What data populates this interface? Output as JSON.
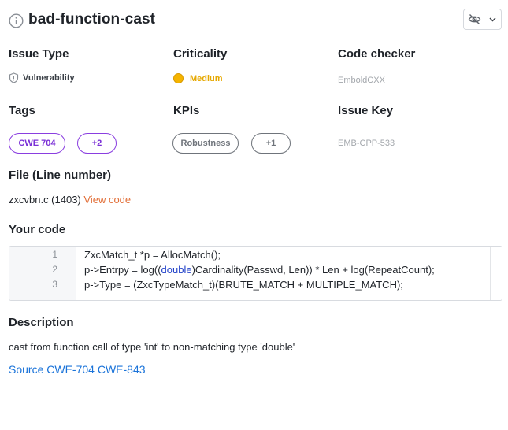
{
  "header": {
    "title": "bad-function-cast",
    "info_icon": "info-circle-icon",
    "visibility_icon": "eye-off-icon",
    "dropdown_icon": "chevron-down-icon"
  },
  "issue_type": {
    "heading": "Issue Type",
    "value": "Vulnerability",
    "icon": "shield-icon"
  },
  "criticality": {
    "heading": "Criticality",
    "value": "Medium",
    "color": "#f5b400"
  },
  "code_checker": {
    "heading": "Code checker",
    "value": "EmboldCXX"
  },
  "tags": {
    "heading": "Tags",
    "items": [
      "CWE 704",
      "+2"
    ],
    "color": "#7a2fd6"
  },
  "kpis": {
    "heading": "KPIs",
    "items": [
      "Robustness",
      "+1"
    ]
  },
  "issue_key": {
    "heading": "Issue Key",
    "value": "EMB-CPP-533"
  },
  "file": {
    "heading": "File (Line number)",
    "name": "zxcvbn.c (1403)",
    "view_code": "View code"
  },
  "your_code": {
    "heading": "Your code",
    "lines": [
      {
        "number": "1",
        "pre": "ZxcMatch_t *p = AllocMatch();",
        "kw": "",
        "post": ""
      },
      {
        "number": "2",
        "pre": "p->Entrpy = log((",
        "kw": "double",
        "post": ")Cardinality(Passwd, Len)) * Len + log(RepeatCount);"
      },
      {
        "number": "3",
        "pre": "p->Type = (ZxcTypeMatch_t)(BRUTE_MATCH + MULTIPLE_MATCH);",
        "kw": "",
        "post": ""
      }
    ]
  },
  "description": {
    "heading": "Description",
    "text": "cast from function call of type 'int' to non-matching type 'double'"
  },
  "source": {
    "label": "Source",
    "links": [
      "CWE-704",
      "CWE-843"
    ]
  }
}
